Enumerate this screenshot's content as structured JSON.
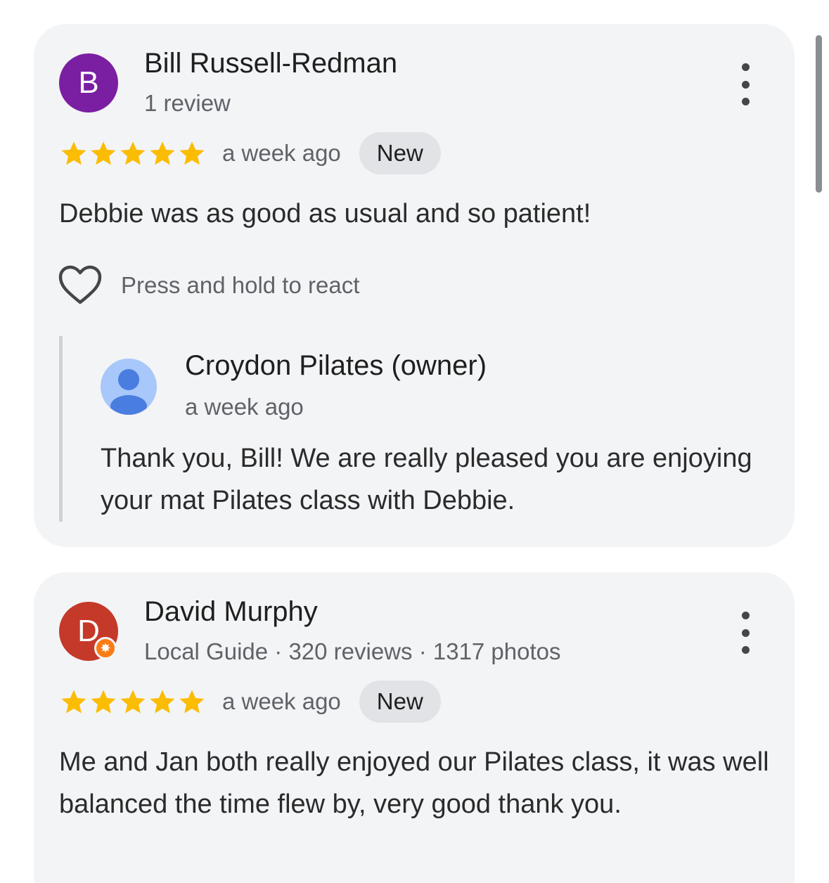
{
  "colors": {
    "avatar_b": "#7b1fa2",
    "avatar_d": "#c53929",
    "star": "#fbbc04",
    "local_guide": "#fa7b17",
    "owner_avatar": "#a8c7fa",
    "owner_avatar_figure": "#4a7de0"
  },
  "reviews": [
    {
      "avatar_letter": "B",
      "name": "Bill Russell-Redman",
      "subtitle": "1 review",
      "rating": 5,
      "time": "a week ago",
      "badge": "New",
      "text": "Debbie was as good as usual and so patient!",
      "react_label": "Press and hold to react",
      "owner_reply": {
        "name": "Croydon Pilates (owner)",
        "time": "a week ago",
        "text": "Thank you, Bill! We are really pleased you are enjoying your mat Pilates class with Debbie."
      }
    },
    {
      "avatar_letter": "D",
      "name": "David Murphy",
      "subtitle": "Local Guide · 320 reviews · 1317 photos",
      "rating": 5,
      "time": "a week ago",
      "badge": "New",
      "text": "Me and Jan both really enjoyed our Pilates class, it was well balanced the time flew by, very good thank you."
    }
  ],
  "icons": {
    "menu": "more-vert-icon",
    "heart": "heart-outline-icon",
    "star": "star-filled-icon",
    "local_guide": "local-guide-badge-icon",
    "owner": "person-icon"
  }
}
